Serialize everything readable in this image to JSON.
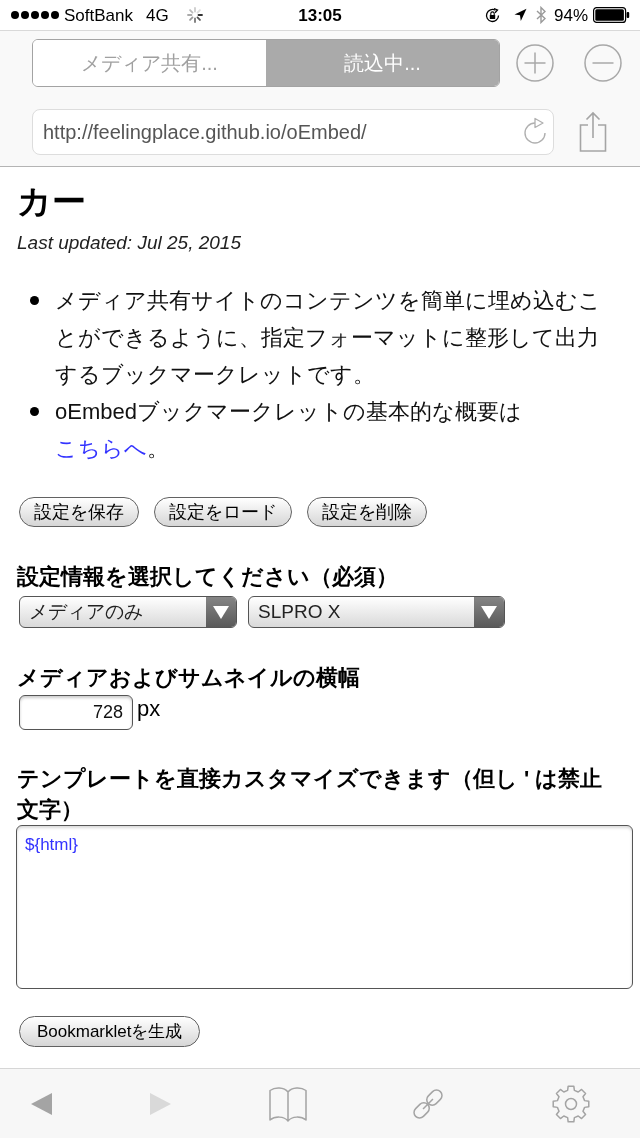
{
  "status_bar": {
    "carrier": "SoftBank",
    "network": "4G",
    "time": "13:05",
    "battery": "94%"
  },
  "tabs": [
    {
      "label": "メディア共有...",
      "selected": false
    },
    {
      "label": "読込中...",
      "selected": true
    }
  ],
  "address_bar": {
    "url": "http://feelingplace.github.io/oEmbed/"
  },
  "page": {
    "title": "カー",
    "last_updated": "Last updated: Jul 25, 2015",
    "bullets": [
      {
        "text": "メディア共有サイトのコンテンツを簡単に埋め込むことができるように、指定フォーマットに整形して出力するブックマークレットです。"
      },
      {
        "text": "oEmbedブックマークレットの基本的な概要は",
        "link": "こちらへ",
        "after": "。"
      }
    ],
    "setting_buttons": [
      "設定を保存",
      "設定をロード",
      "設定を削除"
    ],
    "settings_select": {
      "label": "設定情報を選択してください（必須）",
      "selects": [
        {
          "value": "メディアのみ"
        },
        {
          "value": "SLPRO X"
        }
      ]
    },
    "width_field": {
      "label": "メディアおよびサムネイルの横幅",
      "value": "728",
      "unit": "px"
    },
    "template": {
      "label": "テンプレートを直接カスタマイズできます（但し ' は禁止文字）",
      "value": "${html}"
    },
    "generate_button": "Bookmarkletを生成"
  },
  "bottom_toolbar": {
    "nav_buttons": [
      {
        "kind": "back",
        "disabled": false
      },
      {
        "kind": "forward",
        "disabled": true
      }
    ]
  }
}
